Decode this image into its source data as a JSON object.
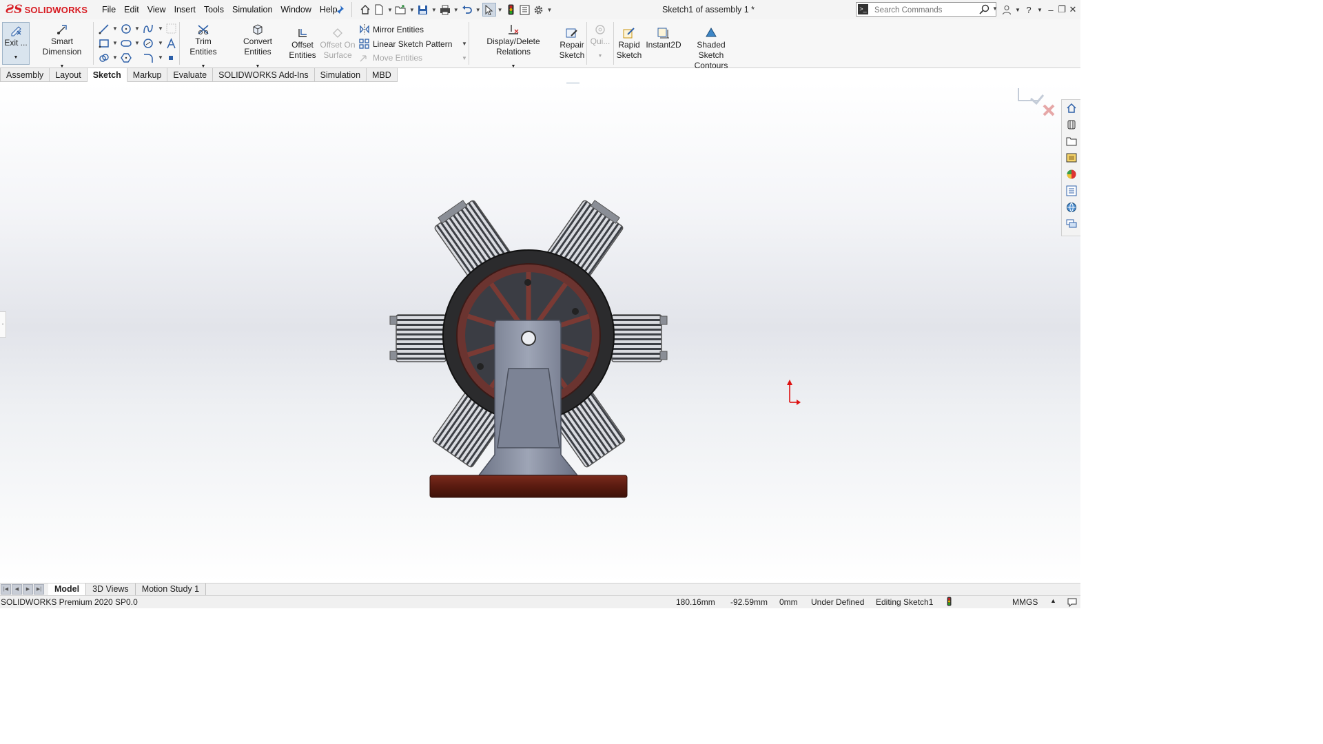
{
  "app": {
    "logo_text": "SOLIDWORKS",
    "doc_title": "Sketch1 of assembly 1 *"
  },
  "menu": [
    "File",
    "Edit",
    "View",
    "Insert",
    "Tools",
    "Simulation",
    "Window",
    "Help"
  ],
  "search": {
    "placeholder": "Search Commands"
  },
  "commands": {
    "exit": "Exit ...",
    "smart_dimension": "Smart Dimension",
    "trim": "Trim Entities",
    "convert": "Convert Entities",
    "offset_1": "Offset",
    "offset_2": "Entities",
    "offset_surface_1": "Offset On",
    "offset_surface_2": "Surface",
    "mirror": "Mirror Entities",
    "linear_pattern": "Linear Sketch Pattern",
    "move": "Move Entities",
    "display_delete": "Display/Delete Relations",
    "repair_1": "Repair",
    "repair_2": "Sketch",
    "quick": "Qui...",
    "rapid_1": "Rapid",
    "rapid_2": "Sketch",
    "instant2d": "Instant2D",
    "shaded_1": "Shaded Sketch",
    "shaded_2": "Contours"
  },
  "tabs": [
    {
      "label": "Assembly",
      "active": false
    },
    {
      "label": "Layout",
      "active": false
    },
    {
      "label": "Sketch",
      "active": true
    },
    {
      "label": "Markup",
      "active": false
    },
    {
      "label": "Evaluate",
      "active": false
    },
    {
      "label": "SOLIDWORKS Add-Ins",
      "active": false
    },
    {
      "label": "Simulation",
      "active": false
    },
    {
      "label": "MBD",
      "active": false
    }
  ],
  "bottom_tabs": [
    {
      "label": "Model",
      "active": true
    },
    {
      "label": "3D Views",
      "active": false
    },
    {
      "label": "Motion Study 1",
      "active": false
    }
  ],
  "status": {
    "product": "SOLIDWORKS Premium 2020 SP0.0",
    "x": "180.16mm",
    "y": "-92.59mm",
    "z": "0mm",
    "state": "Under Defined",
    "mode": "Editing Sketch1",
    "units": "MMGS"
  },
  "colors": {
    "brand": "#d71920",
    "accent": "#1f4e79",
    "wheel": "#7a3a34",
    "base": "#5a1d12",
    "bracket": "#7d8496"
  }
}
